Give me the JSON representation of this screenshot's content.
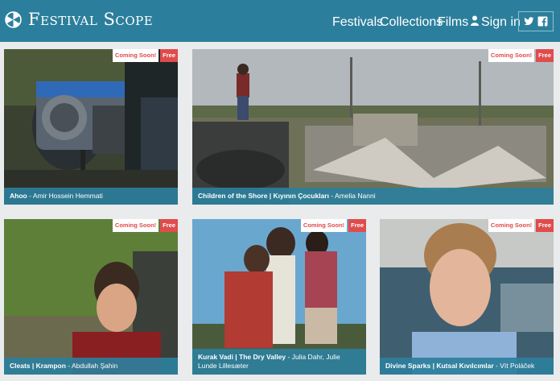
{
  "header": {
    "brand": "Festival Scope",
    "nav": {
      "festivals": "Festivals",
      "collections": "Collections",
      "films": "Films",
      "signin": "Sign in"
    },
    "colors": {
      "bar": "#2c7f9c",
      "badge_red": "#e04c4c"
    }
  },
  "films": [
    {
      "title": "Ahoo",
      "director": "Amir Hossein Hemmati",
      "badge_status": "Coming Soon!",
      "badge_price": "Free"
    },
    {
      "title": "Children of the Shore | Kıyının Çocukları",
      "director": "Amelia Nanni",
      "badge_status": "Coming Soon!",
      "badge_price": "Free"
    },
    {
      "title": "Cleats | Krampon",
      "director": "Abdullah Şahin",
      "badge_status": "Coming Soon!",
      "badge_price": "Free"
    },
    {
      "title": "Kurak Vadi | The Dry Valley",
      "director": "Julia Dahr, Julie Lunde Lillesæter",
      "badge_status": "Coming Soon!",
      "badge_price": "Free"
    },
    {
      "title": "Divine Sparks | Kutsal Kıvılcımlar",
      "director": "Vít Poláček",
      "badge_status": "Coming Soon!",
      "badge_price": "Free"
    }
  ]
}
